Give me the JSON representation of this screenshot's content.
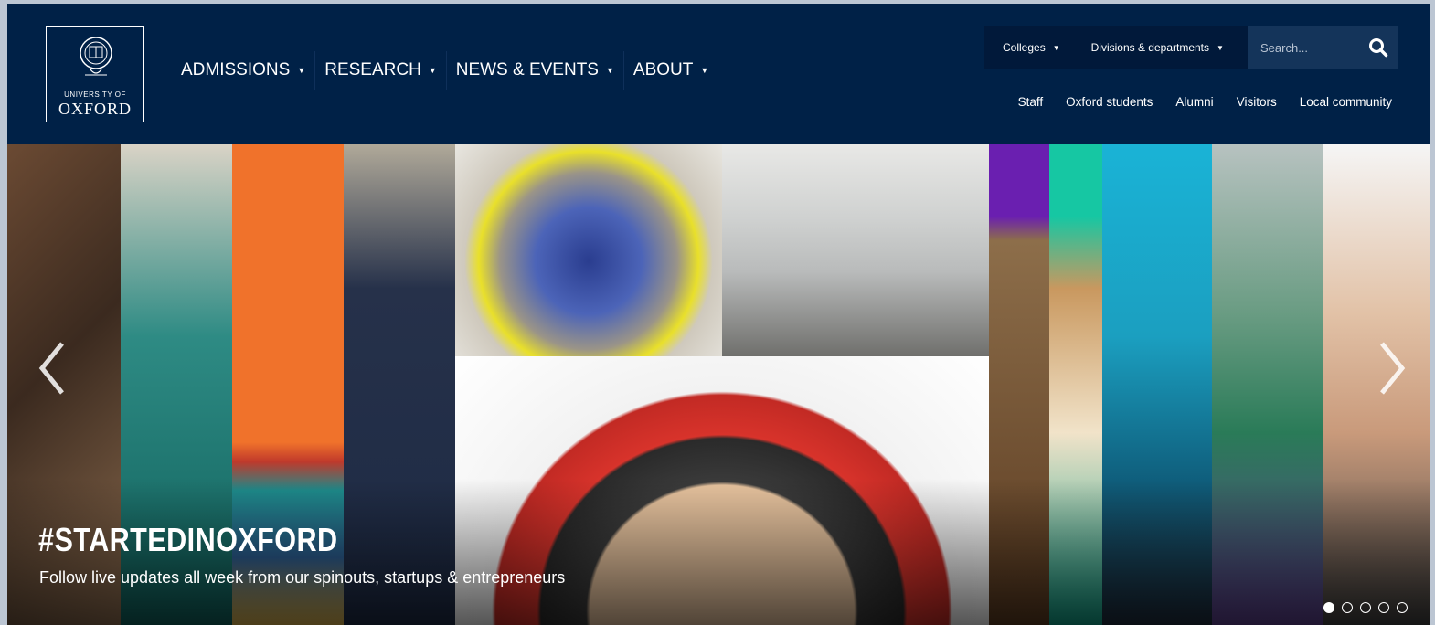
{
  "logo": {
    "line1": "UNIVERSITY OF",
    "line2": "OXFORD"
  },
  "main_nav": [
    {
      "label": "ADMISSIONS",
      "has_dropdown": true
    },
    {
      "label": "RESEARCH",
      "has_dropdown": true
    },
    {
      "label": "NEWS & EVENTS",
      "has_dropdown": true
    },
    {
      "label": "ABOUT",
      "has_dropdown": true
    }
  ],
  "top_bar": {
    "colleges_label": "Colleges",
    "divisions_label": "Divisions & departments"
  },
  "search": {
    "placeholder": "Search..."
  },
  "secondary_nav": [
    "Staff",
    "Oxford students",
    "Alumni",
    "Visitors",
    "Local community"
  ],
  "hero": {
    "title": "#STARTEDINOXFORD",
    "subtitle": "Follow live updates all week from our spinouts, startups & entrepreneurs",
    "slide_count": 5,
    "active_slide": 1
  },
  "colors": {
    "brand_navy": "#002147",
    "topbar_dark": "#01193a",
    "search_bg": "#14345a"
  }
}
